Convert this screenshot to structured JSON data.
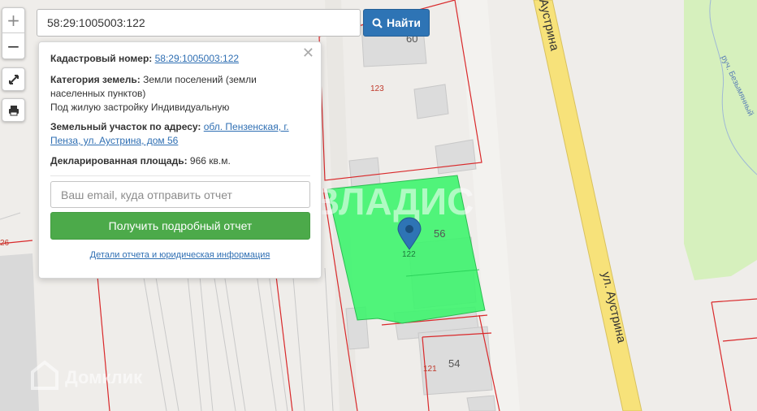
{
  "search": {
    "value": "58:29:1005003:122",
    "button_label": "Найти"
  },
  "zoom": {
    "in_label": "+",
    "out_label": "−"
  },
  "info": {
    "cadastral_label": "Кадастровый номер:",
    "cadastral_value": "58:29:1005003:122",
    "category_label": "Категория земель:",
    "category_value_1": "Земли поселений (земли",
    "category_value_2": "населенных пунктов)",
    "category_value_3": "Под жилую застройку Индивидуальную",
    "address_label": "Земельный участок по адресу:",
    "address_value_1": "обл. Пензенская, г.",
    "address_value_2": "Пенза, ул. Аустрина, дом 56",
    "area_label": "Декларированная площадь:",
    "area_value": "966 кв.м.",
    "email_placeholder": "Ваш email, куда отправить отчет",
    "report_button": "Получить подробный отчет",
    "details_link": "Детали отчета и юридическая информация"
  },
  "map": {
    "house_numbers": [
      "60",
      "56",
      "54"
    ],
    "parcel_numbers": [
      "123",
      "122",
      "121",
      "26"
    ],
    "street_name": "ул. Аустрина",
    "street_name_top": "Аустрина",
    "stream_name": "руч. Безымянный",
    "watermark": "ВЛАДИС",
    "brand_watermark": "Домклик",
    "colors": {
      "background": "#efedea",
      "selected_parcel": "#3ef46e",
      "parcel_border": "#d9292b",
      "road": "#f7e27a",
      "park": "#d6f0bd",
      "accent": "#2e74b5",
      "report_button": "#4caa4a"
    },
    "icons": [
      "location-pin-icon",
      "search-icon",
      "fullscreen-icon",
      "print-icon",
      "close-icon"
    ]
  }
}
